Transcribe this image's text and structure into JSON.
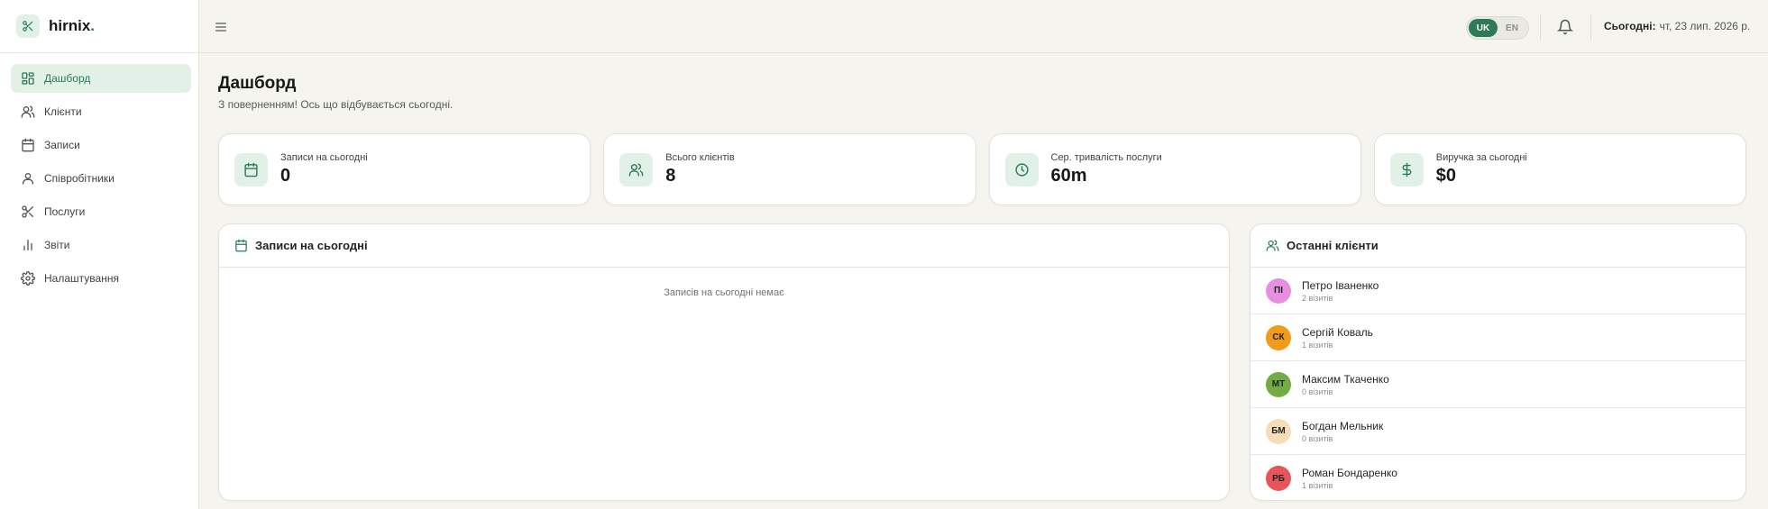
{
  "brand": {
    "name": "hirnix",
    "dot": "."
  },
  "sidebar": {
    "items": [
      {
        "label": "Дашборд",
        "icon": "dashboard-icon",
        "active": true
      },
      {
        "label": "Клієнти",
        "icon": "users-icon"
      },
      {
        "label": "Записи",
        "icon": "calendar-icon"
      },
      {
        "label": "Співробітники",
        "icon": "user-icon"
      },
      {
        "label": "Послуги",
        "icon": "scissors-icon"
      },
      {
        "label": "Звіти",
        "icon": "bar-chart-icon"
      },
      {
        "label": "Налаштування",
        "icon": "gear-icon"
      }
    ]
  },
  "header": {
    "lang": {
      "uk": "UK",
      "en": "EN",
      "selected": "UK"
    },
    "today_label": "Сьогодні:",
    "today_value": "чт, 23 лип. 2026 р."
  },
  "page": {
    "title": "Дашборд",
    "subtitle": "З поверненням! Ось що відбувається сьогодні."
  },
  "stats": [
    {
      "label": "Записи на сьогодні",
      "value": "0",
      "icon": "calendar-icon"
    },
    {
      "label": "Всього клієнтів",
      "value": "8",
      "icon": "users-icon"
    },
    {
      "label": "Сер. тривалість послуги",
      "value": "60m",
      "icon": "clock-icon"
    },
    {
      "label": "Виручка за сьогодні",
      "value": "$0",
      "icon": "dollar-icon"
    }
  ],
  "appointments_panel": {
    "title": "Записи на сьогодні",
    "empty": "Записів на сьогодні немає"
  },
  "clients_panel": {
    "title": "Останні клієнти",
    "items": [
      {
        "initials": "ПІ",
        "name": "Петро Іваненко",
        "visits": "2 візитів",
        "color": "#e88ee0"
      },
      {
        "initials": "СК",
        "name": "Сергій Коваль",
        "visits": "1 візитів",
        "color": "#f29a1a"
      },
      {
        "initials": "МТ",
        "name": "Максим Ткаченко",
        "visits": "0 візитів",
        "color": "#74ab45"
      },
      {
        "initials": "БМ",
        "name": "Богдан Мельник",
        "visits": "0 візитів",
        "color": "#f6ddb8"
      },
      {
        "initials": "РБ",
        "name": "Роман Бондаренко",
        "visits": "1 візитів",
        "color": "#e5555a"
      }
    ]
  },
  "colors": {
    "accent": "#2d7a57",
    "accent_light": "#e2f1e8",
    "background": "#f5f4ee"
  }
}
